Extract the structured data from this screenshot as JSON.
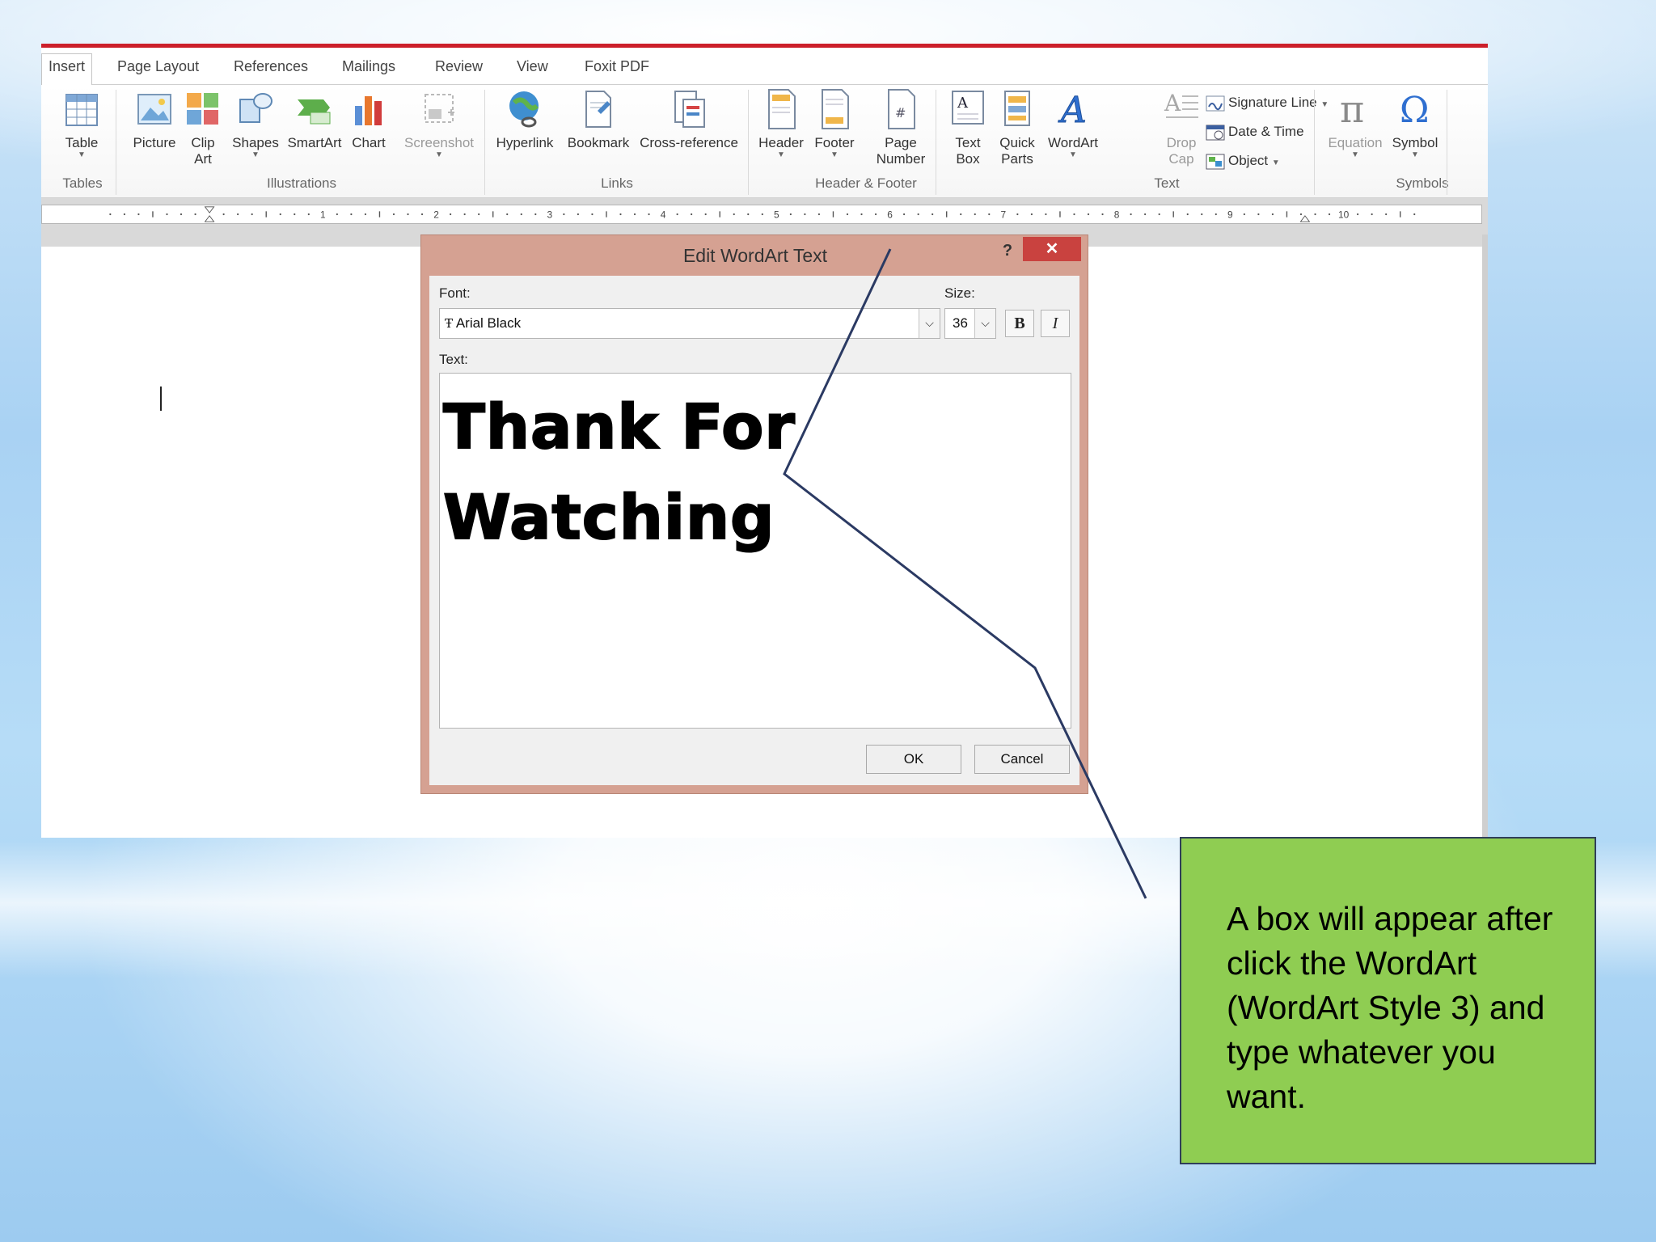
{
  "tabs": [
    "Insert",
    "Page Layout",
    "References",
    "Mailings",
    "Review",
    "View",
    "Foxit PDF"
  ],
  "groups": {
    "tables": "Tables",
    "illustrations": "Illustrations",
    "links": "Links",
    "header_footer": "Header & Footer",
    "text": "Text",
    "symbols": "Symbols"
  },
  "buttons": {
    "table": "Table",
    "picture": "Picture",
    "clip_art_1": "Clip",
    "clip_art_2": "Art",
    "shapes": "Shapes",
    "smartart": "SmartArt",
    "chart": "Chart",
    "screenshot": "Screenshot",
    "hyperlink": "Hyperlink",
    "bookmark": "Bookmark",
    "cross_reference": "Cross-reference",
    "header": "Header",
    "footer": "Footer",
    "page_number_1": "Page",
    "page_number_2": "Number",
    "text_box_1": "Text",
    "text_box_2": "Box",
    "quick_parts_1": "Quick",
    "quick_parts_2": "Parts",
    "wordart": "WordArt",
    "drop_cap_1": "Drop",
    "drop_cap_2": "Cap",
    "signature_line": "Signature Line",
    "date_time": "Date & Time",
    "object": "Object",
    "equation": "Equation",
    "symbol": "Symbol"
  },
  "ruler_numbers": [
    "1",
    "2",
    "3",
    "4",
    "5",
    "6",
    "7",
    "8",
    "9",
    "10"
  ],
  "dialog": {
    "title": "Edit WordArt Text",
    "help": "?",
    "close": "✕",
    "font_label": "Font:",
    "font_value": "Arial Black",
    "size_label": "Size:",
    "size_value": "36",
    "bold": "B",
    "italic": "I",
    "text_label": "Text:",
    "text_line_1": "Thank For",
    "text_line_2": "Watching",
    "ok": "OK",
    "cancel": "Cancel"
  },
  "callout": {
    "text": "A box will appear after click the WordArt (WordArt Style 3) and type whatever you want."
  },
  "colors": {
    "accent_red": "#cc1f2a",
    "dialog_frame": "#d5a192",
    "close_button": "#c9423f",
    "callout_fill": "#8fcd52",
    "callout_border": "#2f3e5a"
  }
}
